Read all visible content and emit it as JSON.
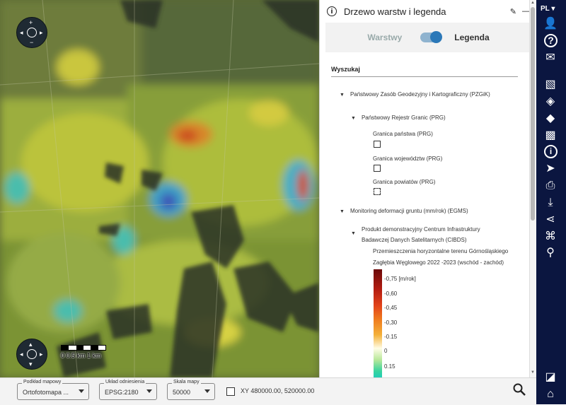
{
  "panel": {
    "title": "Drzewo warstw i legenda",
    "toggle_left": "Warstwy",
    "toggle_right": "Legenda",
    "search_label": "Wyszukaj"
  },
  "tree": {
    "group1": "Państwowy Zasób Geodezyjny i Kartograficzny (PZGiK)",
    "group1_sub": "Państwowy Rejestr Granic (PRG)",
    "layer1": "Granica państwa (PRG)",
    "layer2": "Granica województw (PRG)",
    "layer3": "Granica powiatów (PRG)",
    "group2": "Monitoring  deformacji gruntu (mm/rok) (EGMS)",
    "group2_sub_line1": "Produkt demonstracyjny Centrum Infrastruktury",
    "group2_sub_line2": "Badawczej Danych Satelitarnych (CIBDS)",
    "legend_title_line1": "Przemieszczenia horyzontalne terenu Górnośląskiego",
    "legend_title_line2": "Zagłębia Węglowego 2022 -2023 (wschód - zachód)"
  },
  "legend_ticks": [
    "-0,75 [m/rok]",
    "-0,60",
    "-0,45",
    "-0,30",
    "-0.15",
    "0",
    "0.15"
  ],
  "scalebar": {
    "labels": "0   0.5 km 1 km"
  },
  "statusbar": {
    "basemap_label": "Podkład mapowy",
    "basemap_value": "Ortofotomapa ...",
    "crs_label": "Układ odniesienia",
    "crs_value": "EPSG:2180",
    "scale_label": "Skala mapy",
    "scale_value": "50000",
    "xy_text": "XY 480000.00, 520000.00"
  },
  "toolbar": {
    "lang": "PL",
    "icons": [
      "user-icon",
      "help-icon",
      "mail-icon",
      "map-layers-icon",
      "layers-icon",
      "add-layer-icon",
      "add-map-icon",
      "info-icon",
      "select-pointer-icon",
      "print-icon",
      "download-icon",
      "share-icon",
      "route-icon",
      "location-pin-icon",
      "toggle-map-icon",
      "home-icon"
    ]
  },
  "colors": {
    "toolbar_bg": "#0b1640",
    "toggle_knob": "#2b78b8"
  }
}
